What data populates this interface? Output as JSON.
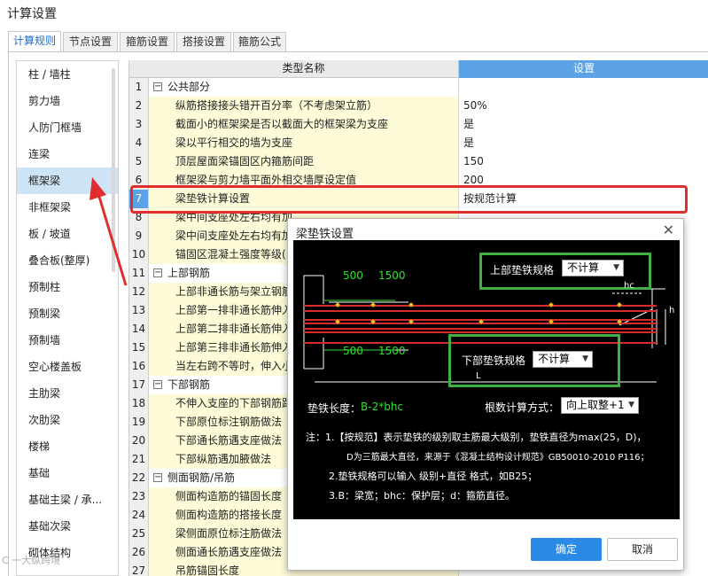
{
  "window": {
    "title": "计算设置"
  },
  "tabs": [
    "计算规则",
    "节点设置",
    "箍筋设置",
    "搭接设置",
    "箍筋公式"
  ],
  "sidebar": {
    "items": [
      "柱 / 墙柱",
      "剪力墙",
      "人防门框墙",
      "连梁",
      "框架梁",
      "非框架梁",
      "板 / 坡道",
      "叠合板(整厚)",
      "预制柱",
      "预制梁",
      "预制墙",
      "空心楼盖板",
      "主肋梁",
      "次肋梁",
      "楼梯",
      "基础",
      "基础主梁 / 承...",
      "基础次梁",
      "砌体结构"
    ],
    "selected": "框架梁"
  },
  "grid": {
    "header_name": "类型名称",
    "header_setting": "设置",
    "rows": [
      {
        "n": "1",
        "name": "公共部分",
        "value": "",
        "group": true
      },
      {
        "n": "2",
        "name": "纵筋搭接接头错开百分率（不考虑架立筋）",
        "value": "50%"
      },
      {
        "n": "3",
        "name": "截面小的框架梁是否以截面大的框架梁为支座",
        "value": "是"
      },
      {
        "n": "4",
        "name": "梁以平行相交的墙为支座",
        "value": "是"
      },
      {
        "n": "5",
        "name": "顶层屋面梁锚固区内箍筋间距",
        "value": "150"
      },
      {
        "n": "6",
        "name": "框架梁与剪力墙平面外相交墙厚设定值",
        "value": "200"
      },
      {
        "n": "7",
        "name": "梁垫铁计算设置",
        "value": "按规范计算",
        "selected": true
      },
      {
        "n": "8",
        "name": "梁中间支座处左右均有加",
        "value": ""
      },
      {
        "n": "9",
        "name": "梁中间支座处左右均有加",
        "value": ""
      },
      {
        "n": "10",
        "name": "锚固区混凝土强度等级(",
        "value": ""
      },
      {
        "n": "11",
        "name": "上部钢筋",
        "value": "",
        "group": true
      },
      {
        "n": "12",
        "name": "上部非通长筋与架立钢筋",
        "value": ""
      },
      {
        "n": "13",
        "name": "上部第一排非通长筋伸入",
        "value": ""
      },
      {
        "n": "14",
        "name": "上部第二排非通长筋伸入",
        "value": ""
      },
      {
        "n": "15",
        "name": "上部第三排非通长筋伸入",
        "value": ""
      },
      {
        "n": "16",
        "name": "当左右跨不等时，伸入小",
        "value": ""
      },
      {
        "n": "17",
        "name": "下部钢筋",
        "value": "",
        "group": true
      },
      {
        "n": "18",
        "name": "不伸入支座的下部钢筋距",
        "value": ""
      },
      {
        "n": "19",
        "name": "下部原位标注钢筋做法",
        "value": ""
      },
      {
        "n": "20",
        "name": "下部通长筋遇支座做法",
        "value": ""
      },
      {
        "n": "21",
        "name": "下部纵筋遇加腋做法",
        "value": ""
      },
      {
        "n": "22",
        "name": "侧面钢筋/吊筋",
        "value": "",
        "group": true
      },
      {
        "n": "23",
        "name": "侧面构造筋的锚固长度",
        "value": ""
      },
      {
        "n": "24",
        "name": "侧面构造筋的搭接长度",
        "value": ""
      },
      {
        "n": "25",
        "name": "梁侧面原位标注筋做法",
        "value": ""
      },
      {
        "n": "26",
        "name": "侧面通长筋遇支座做法",
        "value": ""
      },
      {
        "n": "27",
        "name": "吊筋锚固长度",
        "value": ""
      }
    ]
  },
  "dialog": {
    "title": "梁垫铁设置",
    "close": "✕",
    "dim_a": "500",
    "dim_b": "1500",
    "dim_c": "500",
    "dim_d": "1500",
    "upper_label": "上部垫铁规格",
    "upper_value": "不计算",
    "lower_label": "下部垫铁规格",
    "lower_value": "不计算",
    "hc": "hc",
    "h": "h",
    "L": "L",
    "length_label": "垫铁长度：",
    "length_value": "B-2*bhc",
    "count_label": "根数计算方式：",
    "count_value": "向上取整+1",
    "note1": "注：1.【按规范】表示垫铁的级别取主筋最大级别，垫铁直径为max(25，D)，",
    "note1b": "D为三筋最大直径，来源于《混凝土结构设计规范》GB50010-2010 P116；",
    "note2": "2.垫铁规格可以输入 级别+直径 格式，如B25；",
    "note3": "3.B：梁宽；bhc：保护层；d：箍筋直径。",
    "ok": "确定",
    "cancel": "取消"
  },
  "watermark": "C 一大纵跨境",
  "colors": {
    "accent": "#2b8ae6",
    "highlight": "#e02e2e",
    "green": "#3cb043",
    "name_bg": "#fefbd8"
  }
}
